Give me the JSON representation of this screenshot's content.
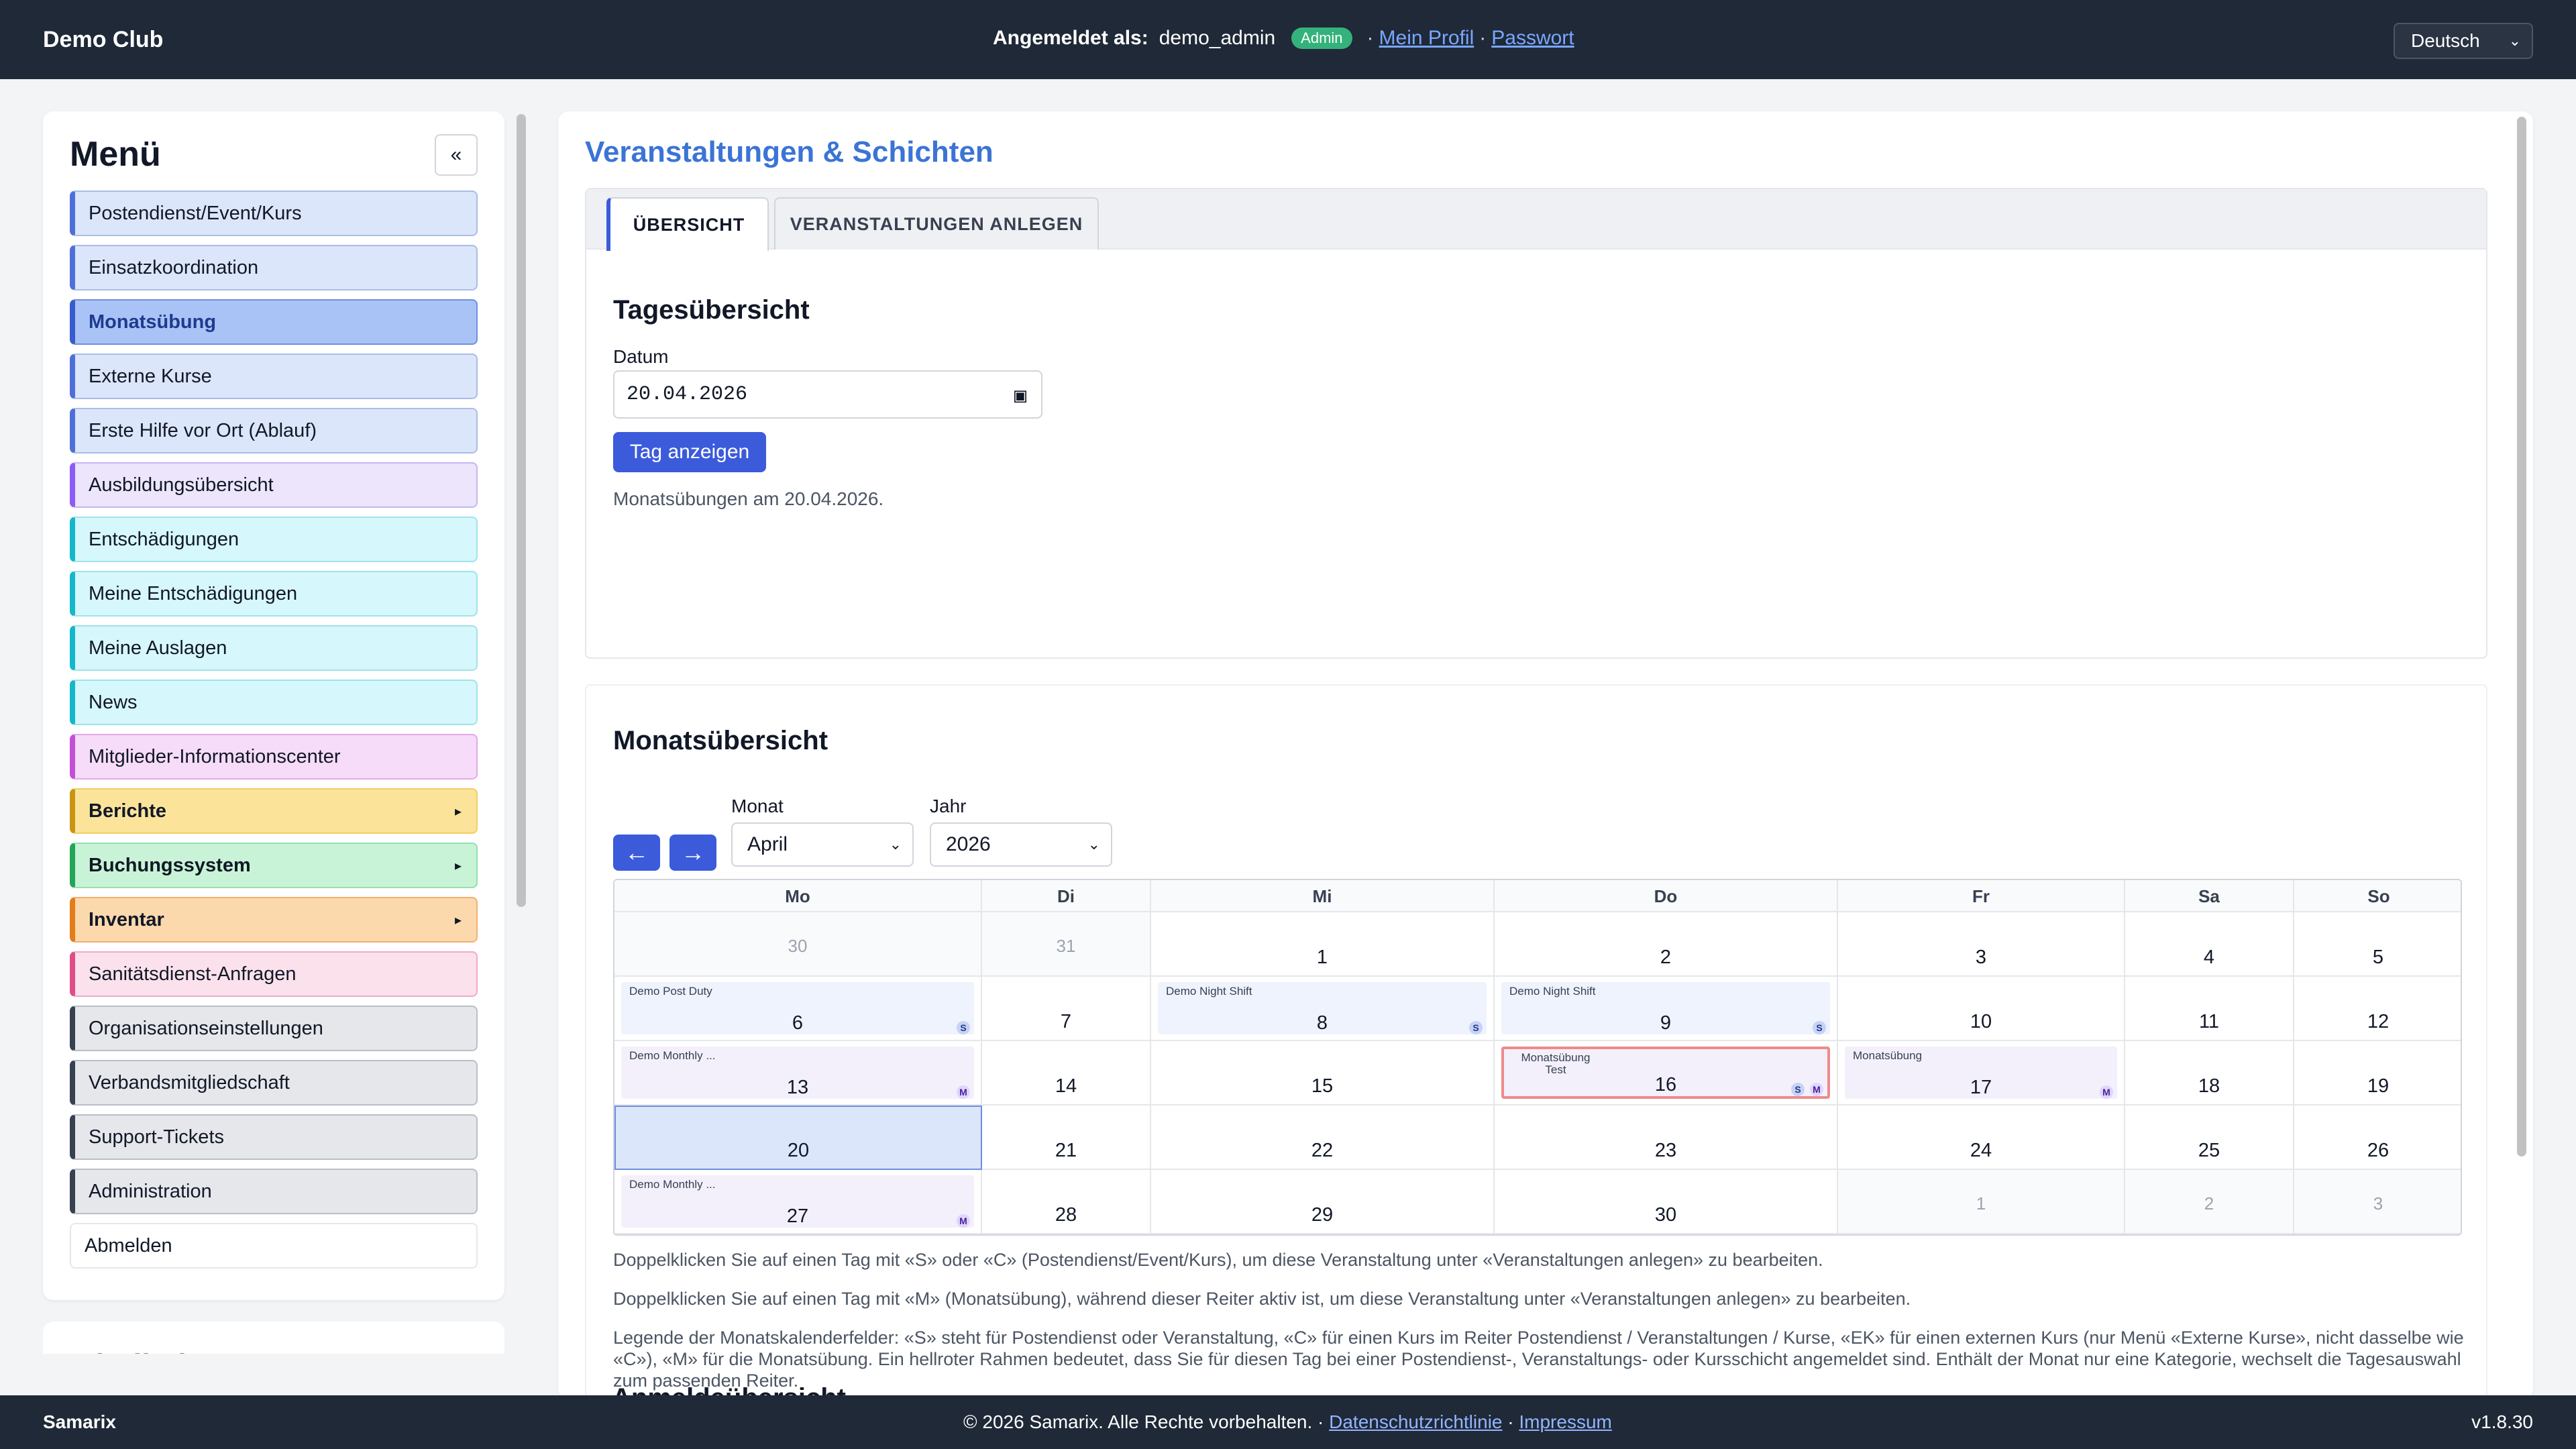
{
  "header": {
    "brand": "Demo Club",
    "logged_in_label": "Angemeldet als:",
    "username": "demo_admin",
    "role_badge": "Admin",
    "sep": "·",
    "profile_link": "Mein Profil",
    "password_link": "Passwort",
    "language": "Deutsch"
  },
  "sidebar": {
    "title": "Menü",
    "collapse_label": "«",
    "items": [
      {
        "label": "Postendienst/Event/Kurs"
      },
      {
        "label": "Einsatzkoordination"
      },
      {
        "label": "Monatsübung"
      },
      {
        "label": "Externe Kurse"
      },
      {
        "label": "Erste Hilfe vor Ort (Ablauf)"
      },
      {
        "label": "Ausbildungsübersicht"
      },
      {
        "label": "Entschädigungen"
      },
      {
        "label": "Meine Entschädigungen"
      },
      {
        "label": "Meine Auslagen"
      },
      {
        "label": "News"
      },
      {
        "label": "Mitglieder-Informationscenter"
      },
      {
        "label": "Berichte",
        "arrow": "▸"
      },
      {
        "label": "Buchungssystem",
        "arrow": "▸"
      },
      {
        "label": "Inventar",
        "arrow": "▸"
      },
      {
        "label": "Sanitätsdienst-Anfragen"
      },
      {
        "label": "Organisationseinstellungen"
      },
      {
        "label": "Verbandsmitgliedschaft"
      },
      {
        "label": "Support-Tickets"
      },
      {
        "label": "Administration"
      },
      {
        "label": "Abmelden"
      }
    ],
    "second_panel_title": "Mitglied"
  },
  "main": {
    "page_title": "Veranstaltungen & Schichten",
    "tabs": [
      {
        "label": "ÜBERSICHT"
      },
      {
        "label": "VERANSTALTUNGEN ANLEGEN"
      }
    ],
    "day_overview": {
      "title": "Tagesübersicht",
      "date_label": "Datum",
      "date_value": "20.04.2026",
      "show_button": "Tag anzeigen",
      "info": "Monatsübungen am 20.04.2026."
    },
    "month_overview": {
      "title": "Monatsübersicht",
      "prev": "←",
      "next": "→",
      "month_label": "Monat",
      "month_value": "April",
      "year_label": "Jahr",
      "year_value": "2026",
      "weekdays": [
        "Mo",
        "Di",
        "Mi",
        "Do",
        "Fr",
        "Sa",
        "So"
      ],
      "weeks": [
        [
          "30",
          "31",
          "1",
          "2",
          "3",
          "4",
          "5"
        ],
        [
          "6",
          "7",
          "8",
          "9",
          "10",
          "11",
          "12"
        ],
        [
          "13",
          "14",
          "15",
          "16",
          "17",
          "18",
          "19"
        ],
        [
          "20",
          "21",
          "22",
          "23",
          "24",
          "25",
          "26"
        ],
        [
          "27",
          "28",
          "29",
          "30",
          "1",
          "2",
          "3"
        ]
      ],
      "events": {
        "d6": {
          "label": "Demo Post Duty",
          "badges": "S"
        },
        "d8": {
          "label": "Demo Night Shift",
          "badges": "S"
        },
        "d9": {
          "label": "Demo Night Shift",
          "badges": "S"
        },
        "d13": {
          "label": "Demo Monthly ...",
          "badges": "M"
        },
        "d16": {
          "label": "Monatsübung Test",
          "badges": "S M"
        },
        "d17": {
          "label": "Monatsübung",
          "badges": "M"
        },
        "d27": {
          "label": "Demo Monthly ...",
          "badges": "M"
        }
      },
      "help_1": "Doppelklicken Sie auf einen Tag mit «S» oder «C» (Postendienst/Event/Kurs), um diese Veranstaltung unter «Veranstaltungen anlegen» zu bearbeiten.",
      "help_2": "Doppelklicken Sie auf einen Tag mit «M» (Monatsübung), während dieser Reiter aktiv ist, um diese Veranstaltung unter «Veranstaltungen anlegen» zu bearbeiten.",
      "legend": "Legende der Monatskalenderfelder: «S» steht für Postendienst oder Veranstaltung, «C» für einen Kurs im Reiter Postendienst / Veranstaltungen / Kurse, «EK» für einen externen Kurs (nur Menü «Externe Kurse», nicht dasselbe wie «C»), «M» für die Monatsübung. Ein hellroter Rahmen bedeutet, dass Sie für diesen Tag bei einer Postendienst-, Veranstaltungs- oder Kursschicht angemeldet sind. Enthält der Monat nur eine Kategorie, wechselt die Tagesauswahl zum passenden Reiter."
    },
    "next_section_partial": "Anmeldeübersicht"
  },
  "footer": {
    "brand": "Samarix",
    "copyright": "© 2026 Samarix. Alle Rechte vorbehalten. ·",
    "privacy_link": "Datenschutzrichtlinie",
    "sep": "·",
    "imprint_link": "Impressum",
    "version": "v1.8.30"
  },
  "colors": {
    "topbar": "#1f2937",
    "accent": "#3b5bdb",
    "title_blue": "#3b74d6",
    "admin_badge": "#34b27b"
  }
}
